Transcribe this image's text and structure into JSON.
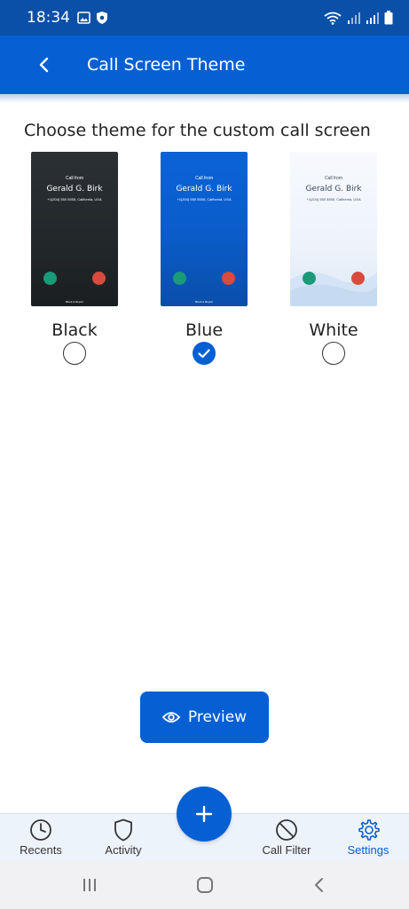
{
  "status_bar": {
    "time": "18:34"
  },
  "app_bar": {
    "title": "Call Screen Theme"
  },
  "heading": "Choose theme for the custom call screen",
  "themes": [
    {
      "label": "Black",
      "selected": false
    },
    {
      "label": "Blue",
      "selected": true
    },
    {
      "label": "White",
      "selected": false
    }
  ],
  "thumbnail": {
    "call_from": "Call from",
    "caller_name": "Gerald G. Birk",
    "caller_phone": "+1(204) 550 5555, California, USA",
    "block_label": "Block & Report"
  },
  "preview_button": {
    "label": "Preview"
  },
  "bottom_nav": {
    "items": [
      {
        "label": "Recents",
        "icon": "clock-icon"
      },
      {
        "label": "Activity",
        "icon": "shield-icon"
      },
      {
        "label": "Call Filter",
        "icon": "block-icon"
      },
      {
        "label": "Settings",
        "icon": "gear-icon",
        "active": true
      }
    ]
  },
  "colors": {
    "primary": "#0660d4",
    "status_bar": "#0a4fa8",
    "accept": "#1a9a78",
    "decline": "#d94b3d"
  }
}
